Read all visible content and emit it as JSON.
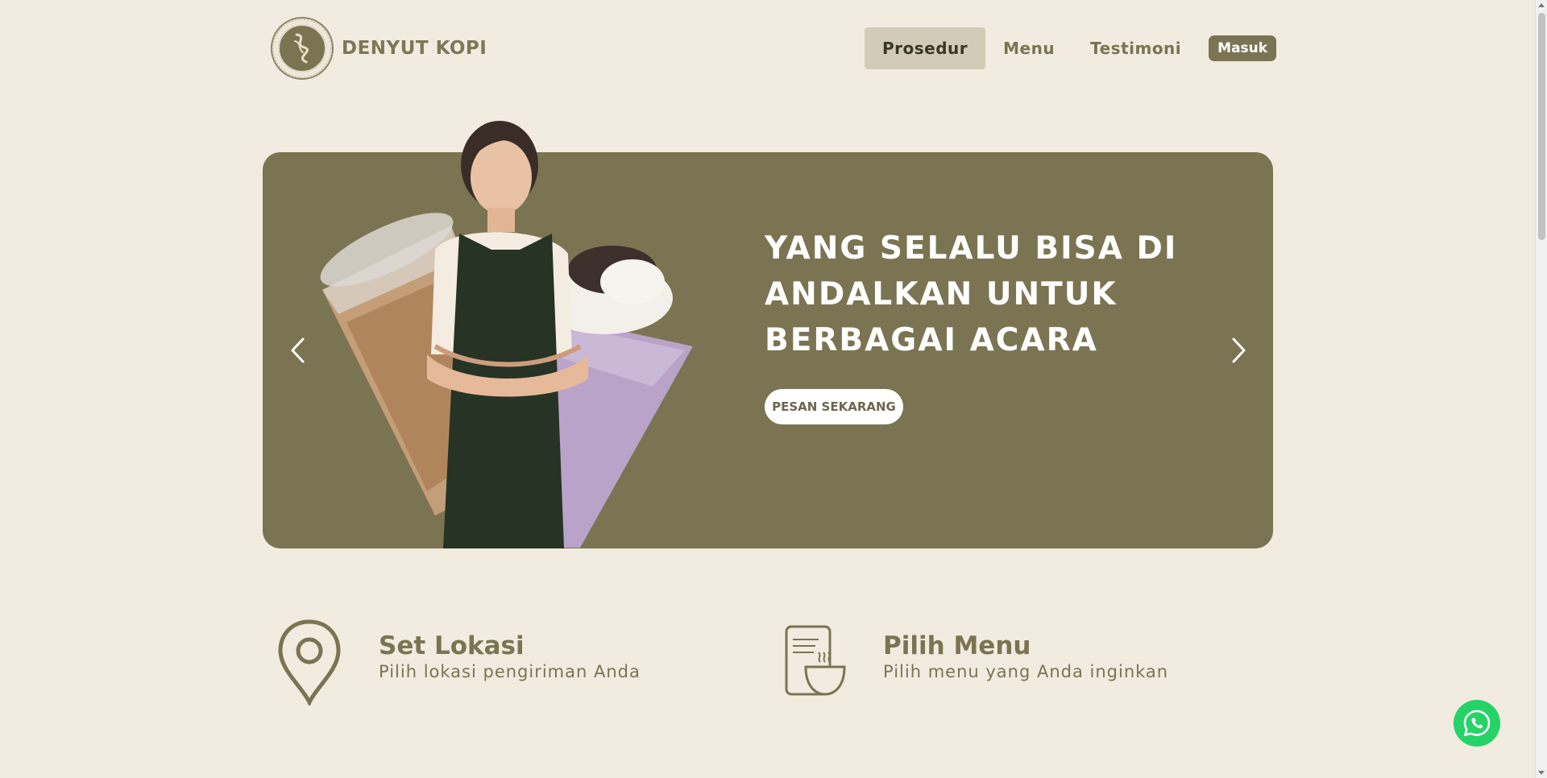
{
  "brand": {
    "name": "DENYUT KOPI",
    "logo_icon": "coffee-bean-logo"
  },
  "nav": {
    "items": [
      {
        "label": "Prosedur",
        "active": true
      },
      {
        "label": "Menu",
        "active": false
      },
      {
        "label": "Testimoni",
        "active": false
      }
    ],
    "login_label": "Masuk"
  },
  "hero": {
    "title_lines": [
      "YANG SELALU BISA DI",
      "ANDALKAN UNTUK",
      "BERBAGAI ACARA"
    ],
    "cta_label": "PESAN SEKARANG",
    "prev_icon": "chevron-left-icon",
    "next_icon": "chevron-right-icon",
    "background_color": "#7b7452"
  },
  "features": [
    {
      "icon": "map-pin-icon",
      "title": "Set Lokasi",
      "description": "Pilih lokasi pengiriman Anda"
    },
    {
      "icon": "menu-bowl-icon",
      "title": "Pilih Menu",
      "description": "Pilih menu yang Anda inginkan"
    }
  ],
  "floating": {
    "icon": "whatsapp-icon",
    "color": "#25d366"
  },
  "colors": {
    "accent": "#7b7452",
    "background": "#f2ebe0",
    "active_nav": "#d2cbb8"
  }
}
